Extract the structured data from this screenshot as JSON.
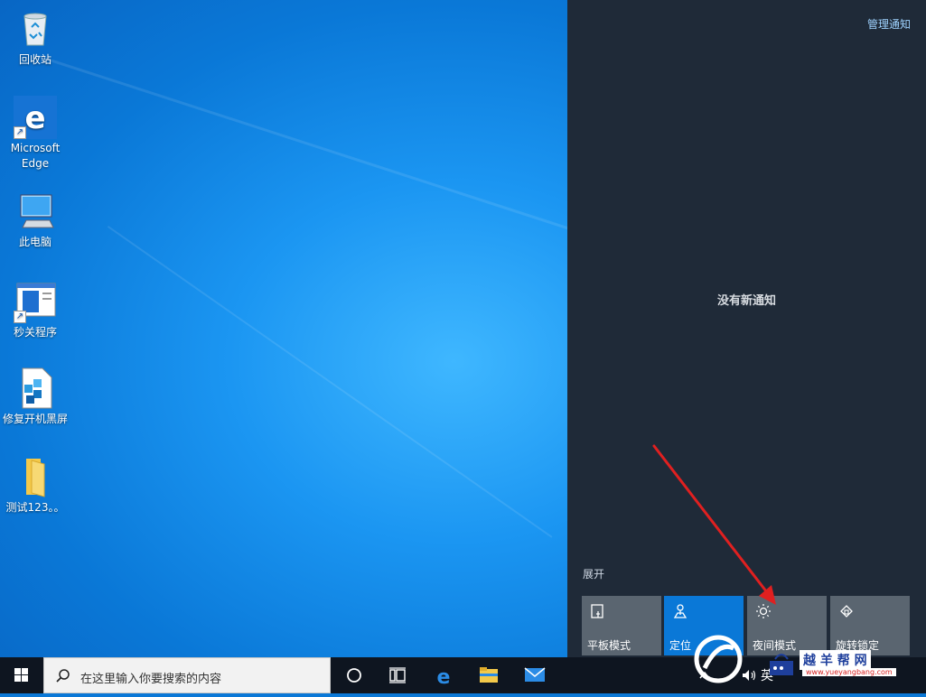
{
  "desktop": {
    "icons": [
      {
        "label": "回收站"
      },
      {
        "label": "Microsoft Edge"
      },
      {
        "label": "此电脑"
      },
      {
        "label": "秒关程序"
      },
      {
        "label": "修复开机黑屏"
      },
      {
        "label": "测试123。。"
      }
    ]
  },
  "action_center": {
    "manage_notifications": "管理通知",
    "no_notifications": "没有新通知",
    "expand": "展开",
    "tiles": [
      {
        "label": "平板模式",
        "icon": "tablet-mode-icon",
        "active": false
      },
      {
        "label": "定位",
        "icon": "location-icon",
        "active": true
      },
      {
        "label": "夜间模式",
        "icon": "brightness-icon",
        "active": false
      },
      {
        "label": "旋转锁定",
        "icon": "rotation-lock-icon",
        "active": false
      }
    ]
  },
  "taskbar": {
    "search_placeholder": "在这里输入你要搜索的内容",
    "tray_language": "英"
  },
  "watermark": {
    "text": "越 羊 帮 网",
    "url": "www.yueyangbang.com"
  },
  "colors": {
    "desktop_blue": "#0a78d7",
    "action_center_bg": "#1f2a38",
    "tile_active": "#0a78d7",
    "tile_inactive": "#5a6570",
    "annotation_red": "#e02020"
  }
}
